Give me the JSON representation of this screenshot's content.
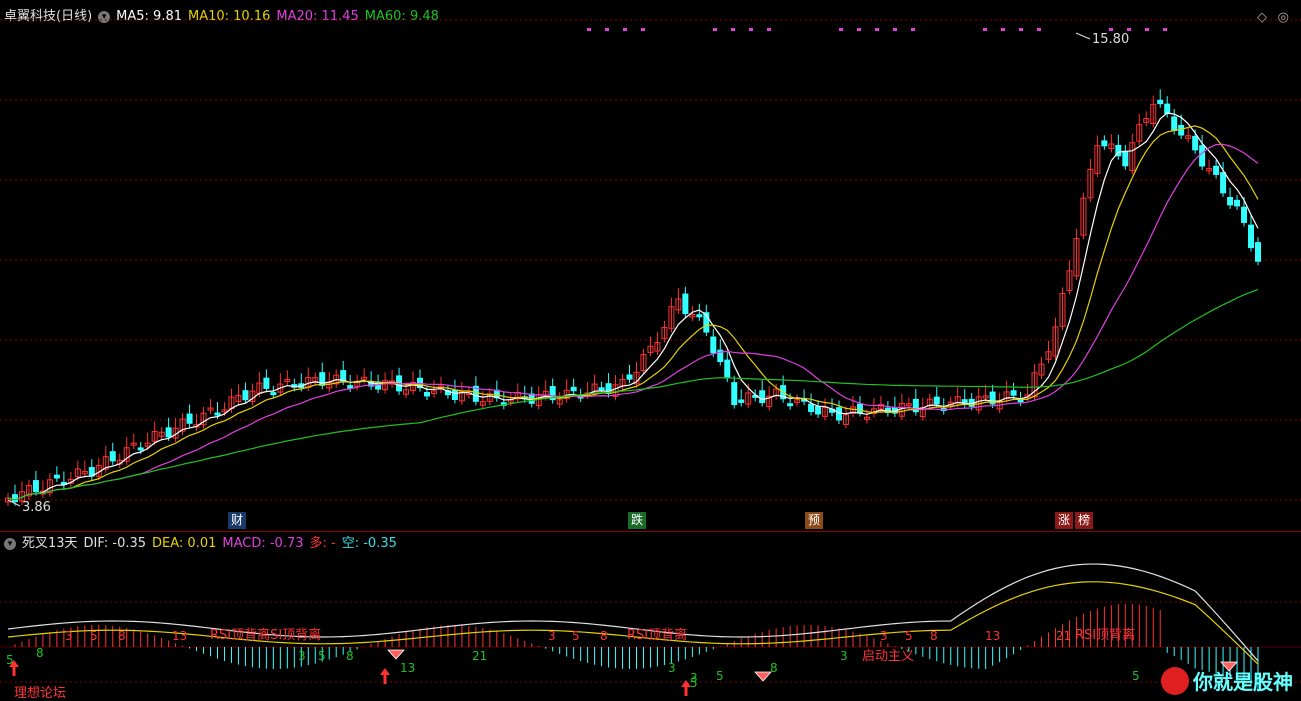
{
  "main": {
    "stock_title": "卓翼科技(日线)",
    "ma5": "MA5: 9.81",
    "ma10": "MA10: 10.16",
    "ma20": "MA20: 11.45",
    "ma60": "MA60: 9.48",
    "high_label": "15.80",
    "low_label": "3.86",
    "tags": [
      "财",
      "跌",
      "预",
      "涨",
      "榜"
    ]
  },
  "macd": {
    "title": "死叉13天",
    "dif": "DIF: -0.35",
    "dea": "DEA: 0.01",
    "macd": "MACD: -0.73",
    "duo": "多: -",
    "kong": "空: -0.35",
    "annotations": [
      "RSI顶背离SI顶背离",
      "RSI顶背离",
      "启动主义",
      "RSI顶背离"
    ],
    "numbers_up": [
      "3",
      "5",
      "8",
      "13",
      "3",
      "5",
      "8",
      "3",
      "5",
      "8",
      "13",
      "21"
    ],
    "numbers_down": [
      "5",
      "8",
      "3",
      "5",
      "8",
      "21",
      "3",
      "5",
      "13",
      "3",
      "5",
      "8",
      "3",
      "5",
      "3",
      "5"
    ],
    "footer_text": "理想论坛"
  },
  "watermark": {
    "text": "你就是股神"
  },
  "colors": {
    "ma5": "#ffffff",
    "ma10": "#e6d200",
    "ma20": "#e040e0",
    "ma60": "#20c020",
    "up": "#ff3232",
    "down": "#32ffff",
    "dif": "#e0e0e0",
    "dea": "#e6d200",
    "grid": "#8b0000"
  },
  "chart_data": {
    "type": "candlestick",
    "high": 15.8,
    "low": 3.86,
    "series": [
      {
        "name": "MA5",
        "value": 9.81
      },
      {
        "name": "MA10",
        "value": 10.16
      },
      {
        "name": "MA20",
        "value": 11.45
      },
      {
        "name": "MA60",
        "value": 9.48
      }
    ]
  }
}
